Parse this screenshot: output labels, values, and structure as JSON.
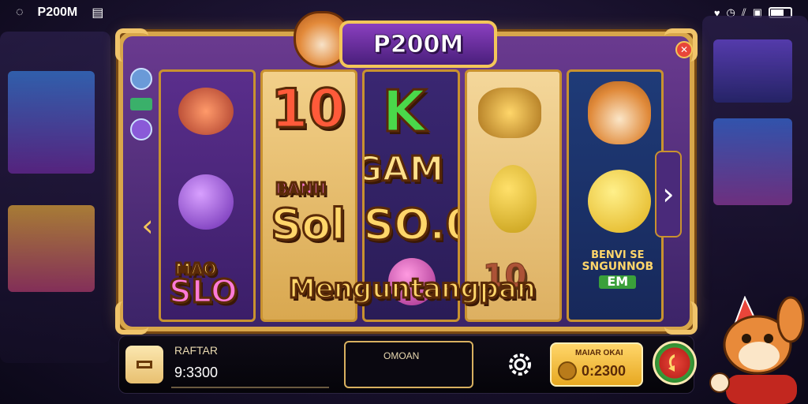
{
  "statusbar": {
    "app_name": "P200M",
    "icons": [
      "notification-icon",
      "heart-icon",
      "alarm-icon",
      "signal-icon",
      "screen-icon",
      "battery-icon"
    ]
  },
  "logo": {
    "text": "P200M"
  },
  "reels": {
    "headline_1": "10",
    "headline_2": "K",
    "game_word": "GAM",
    "small_caption": "BANH",
    "slot_word_1": "Sol",
    "slot_word_2": "SO.0",
    "left_word_top": "MAO",
    "left_word": "SLO",
    "banner": "Menguntangpan",
    "right_banner_line1": "BENVI SE",
    "right_banner_line2": "SNGUNNOB",
    "right_banner_line3": "EM",
    "number_badge": "10"
  },
  "side_nav": {
    "left": "‹",
    "right": "›"
  },
  "bottom_bar": {
    "credit_label": "RAFTAR",
    "credit_value": "9:3300",
    "mid_label": "OMOAN",
    "win_label": "MAIAR OKAI",
    "win_value": "0:2300"
  },
  "colors": {
    "frame_gold": "#d8a64a",
    "purple": "#6a3a8f",
    "win_gold": "#ffd66a",
    "spin_red": "#e8453a"
  }
}
